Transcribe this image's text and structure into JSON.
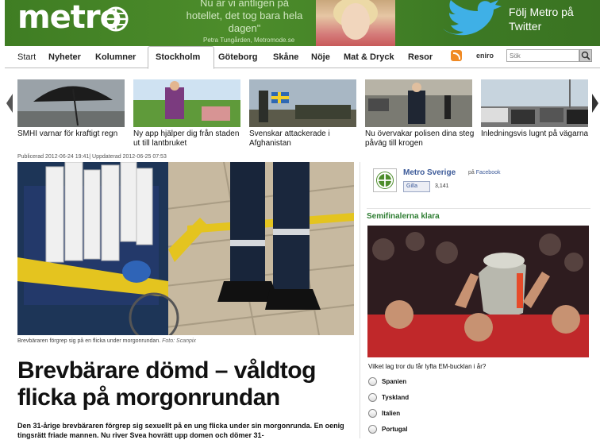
{
  "header": {
    "logo_text": "metro",
    "quote": "Nu är vi antligen på hotellet, det tog bara hela dagen\"",
    "quote_author": "Petra Tungården, Metromode.se",
    "twitter_promo": "Följ Metro på Twitter"
  },
  "nav": {
    "items": [
      "Start",
      "Nyheter",
      "Kolumner",
      "Stockholm",
      "Göteborg",
      "Skåne",
      "Nöje",
      "Mat & Dryck",
      "Resor"
    ],
    "active": "Stockholm",
    "eniro_label": "eniro",
    "search_placeholder": "Sök"
  },
  "carousel": {
    "items": [
      {
        "caption": "SMHI varnar för kraftigt regn"
      },
      {
        "caption": "Ny app hjälper dig från staden ut till lantbruket"
      },
      {
        "caption": "Svenskar attackerade i Afghanistan"
      },
      {
        "caption": "Nu övervakar polisen dina steg påväg till krogen"
      },
      {
        "caption": "Inledningsvis lugnt på vägarna"
      }
    ]
  },
  "article": {
    "published": "Publicerad 2012-06-24 19:41| Uppdaterad 2012-06-25 07:53",
    "image_caption": "Brevbäraren förgrep sig på en flicka under morgonrundan.",
    "image_credit": "Foto: Scanpix",
    "headline": "Brevbärare dömd – våldtog flicka på morgonrundan",
    "lead": "Den 31-årige brevbäraren förgrep sig sexuellt på en ung flicka under sin morgonrunda. En oenig tingsrätt friade mannen. Nu river Svea hovrätt upp domen och dömer 31-"
  },
  "sidebar": {
    "fb_name": "Metro Sverige",
    "fb_on": "på",
    "fb_platform": "Facebook",
    "fb_like": "Gilla",
    "fb_count": "3,141",
    "section_heading": "Semifinalerna klara",
    "poll_question": "Vilket lag tror du får lyfta EM-bucklan i år?",
    "poll_options": [
      "Spanien",
      "Tyskland",
      "Italien",
      "Portugal"
    ]
  },
  "colors": {
    "brand_green": "#3f7d23",
    "twitter_blue": "#3fb0e6",
    "facebook_blue": "#3b5998",
    "section_green": "#2e7d32"
  }
}
